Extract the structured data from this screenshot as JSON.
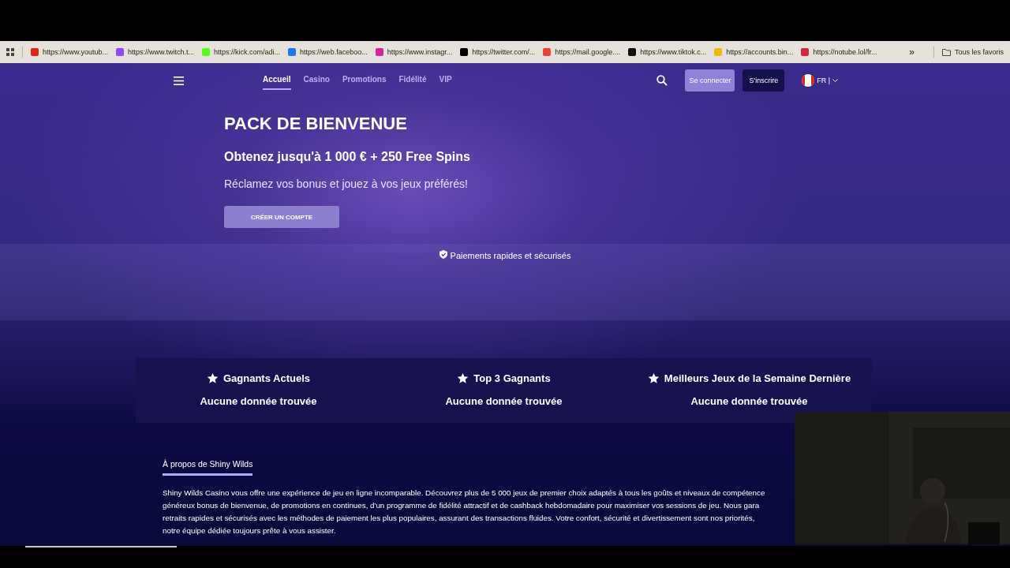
{
  "bookmarks_bar": {
    "items": [
      {
        "label": "https://www.youtub...",
        "color": "#e62117"
      },
      {
        "label": "https://www.twitch.t...",
        "color": "#9146ff"
      },
      {
        "label": "https://kick.com/adi...",
        "color": "#53fc18"
      },
      {
        "label": "https://web.faceboo...",
        "color": "#1877f2"
      },
      {
        "label": "https://www.instagr...",
        "color": "#d6249f"
      },
      {
        "label": "https://twitter.com/...",
        "color": "#000000"
      },
      {
        "label": "https://mail.google....",
        "color": "#ea4335"
      },
      {
        "label": "https://www.tiktok.c...",
        "color": "#111111"
      },
      {
        "label": "https://accounts.bin...",
        "color": "#f0b90b"
      },
      {
        "label": "https://notube.lol/fr...",
        "color": "#d8243a"
      }
    ],
    "overflow": "»",
    "all_bookmarks": "Tous les favoris"
  },
  "nav": {
    "tabs": [
      {
        "label": "Accueil",
        "selected": true
      },
      {
        "label": "Casino",
        "selected": false
      },
      {
        "label": "Promotions",
        "selected": false
      },
      {
        "label": "Fidélité",
        "selected": false
      },
      {
        "label": "VIP",
        "selected": false
      }
    ],
    "login": "Se connecter",
    "signup": "S'inscrire",
    "language": "FR |"
  },
  "hero": {
    "title": "PACK DE BIENVENUE",
    "subtitle": "Obtenez jusqu'à 1 000 € + 250 Free Spins",
    "text": "Réclamez vos bonus et jouez à vos jeux préférés!",
    "button": "CRÉER UN COMPTE"
  },
  "trust_band": {
    "text": "Paiements rapides et sécurisés"
  },
  "stats": [
    {
      "title": "Gagnants Actuels",
      "value": "Aucune donnée trouvée"
    },
    {
      "title": "Top 3 Gagnants",
      "value": "Aucune donnée trouvée"
    },
    {
      "title": "Meilleurs Jeux de la Semaine Dernière",
      "value": "Aucune donnée trouvée"
    }
  ],
  "about": {
    "heading": "À propos de Shiny Wilds",
    "lines": [
      "Shiny Wilds Casino vous offre une expérience de jeu en ligne incomparable. Découvrez plus de 5 000 jeux de premier choix adaptés à tous les goûts et niveaux de compétence",
      "généreux bonus de bienvenue, de promotions en continues, d'un programme de fidélité attractif et de cashback hebdomadaire pour maximiser vos sessions de jeu. Nous gara",
      "retraits rapides et sécurisés avec les méthodes de paiement les plus populaires, assurant des transactions fluides. Votre confort, sécurité et divertissement sont nos priorités,",
      "notre équipe dédiée toujours prête à vous assister."
    ]
  }
}
